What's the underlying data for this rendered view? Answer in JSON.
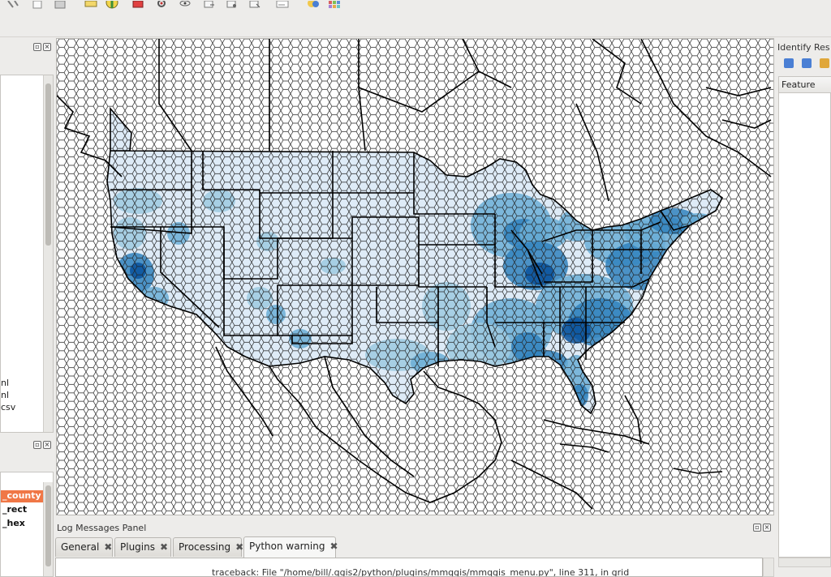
{
  "identify_panel": {
    "title": "Identify Res",
    "column_header": "Feature"
  },
  "left_panel": {
    "items": [
      "nl",
      "nl",
      "csv"
    ]
  },
  "layers": {
    "items": [
      "_county",
      "_rect",
      "_hex"
    ],
    "selected_index": 0
  },
  "log_panel": {
    "title": "Log Messages Panel",
    "tabs": [
      {
        "label": "General"
      },
      {
        "label": "Plugins"
      },
      {
        "label": "Processing"
      },
      {
        "label": "Python warning"
      }
    ],
    "active_tab_index": 3,
    "message": "traceback:  File \"/home/bill/.qgis2/python/plugins/mmqgis/mmqgis_menu.py\", line 311, in grid"
  },
  "map": {
    "colors": {
      "background": "#ffffff",
      "grid_stroke": "#111111",
      "border_stroke": "#000000",
      "choropleth": [
        "#deebf7",
        "#c6dbef",
        "#9ecae1",
        "#6baed6",
        "#3182bd",
        "#08519c"
      ]
    }
  },
  "toolbar": {
    "icons": [
      "measure-icon",
      "new-project-icon",
      "save-icon",
      "map-tips-icon",
      "identify-icon",
      "select-icon",
      "zoom-icon",
      "view-icon",
      "add-layer-icon",
      "add-vector-icon",
      "add-raster-icon",
      "python-console-icon",
      "palette-icon"
    ]
  }
}
